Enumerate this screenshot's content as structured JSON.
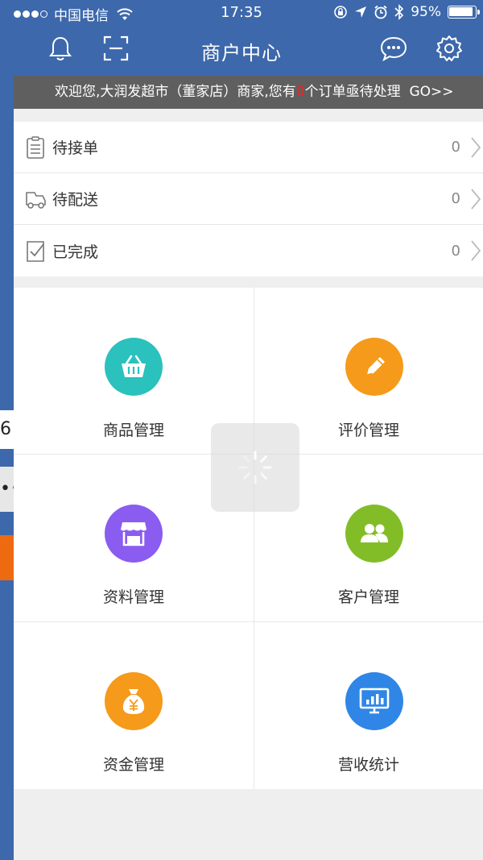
{
  "status_bar": {
    "carrier": "中国电信",
    "time": "17:35",
    "battery": "95%",
    "battery_level": 0.95
  },
  "header": {
    "title": "商户中心"
  },
  "notice": {
    "prefix": "欢迎您,大润发超市（董家店）商家,您有",
    "count": "0",
    "suffix": "个订单亟待处理",
    "go": "GO>>"
  },
  "orders": [
    {
      "label": "待接单",
      "value": "0",
      "icon": "clipboard-icon"
    },
    {
      "label": "待配送",
      "value": "0",
      "icon": "delivery-icon"
    },
    {
      "label": "已完成",
      "value": "0",
      "icon": "checked-doc-icon"
    }
  ],
  "grid": [
    {
      "label": "商品管理",
      "icon": "basket-icon",
      "color": "#2bc1bd"
    },
    {
      "label": "评价管理",
      "icon": "pencil-icon",
      "color": "#f59a1b"
    },
    {
      "label": "资料管理",
      "icon": "store-icon",
      "color": "#8a5cf0"
    },
    {
      "label": "客户管理",
      "icon": "users-icon",
      "color": "#82bd28"
    },
    {
      "label": "资金管理",
      "icon": "money-bag-icon",
      "color": "#f59a1b"
    },
    {
      "label": "营收统计",
      "icon": "monitor-chart-icon",
      "color": "#2f86e6"
    }
  ],
  "background_fragments": {
    "digit": "6",
    "dots": "••"
  },
  "colors": {
    "header": "#3d68ab",
    "notice_bg": "#5f5f5f",
    "notice_count": "#ff1f1f"
  }
}
